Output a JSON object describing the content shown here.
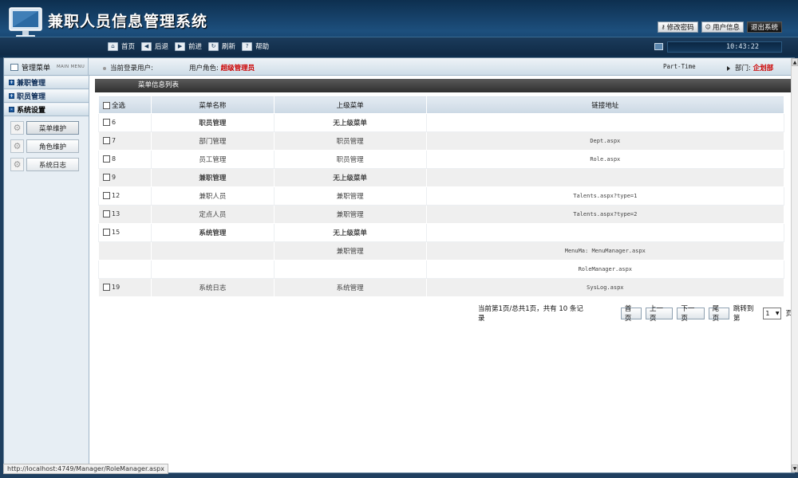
{
  "app": {
    "title": "兼职人员信息管理系统"
  },
  "header_buttons": [
    {
      "label": "修改密码",
      "icon": "key-icon"
    },
    {
      "label": "用户信息",
      "icon": "user-icon"
    },
    {
      "label": "退出系统",
      "icon": ""
    }
  ],
  "toolbar": {
    "items": [
      {
        "label": "首页",
        "icon": "home-icon",
        "glyph": "⌂"
      },
      {
        "label": "后退",
        "icon": "back-arrow-icon",
        "glyph": "◀"
      },
      {
        "label": "前进",
        "icon": "forward-arrow-icon",
        "glyph": "▶"
      },
      {
        "label": "刷新",
        "icon": "refresh-icon",
        "glyph": "↻"
      },
      {
        "label": "帮助",
        "icon": "help-icon",
        "glyph": "?"
      }
    ],
    "clock": "10:43:22"
  },
  "infobar": {
    "menu_title": "管理菜单",
    "menu_title_en": "MAIN MENU",
    "current_user_label": "当前登录用户:",
    "role_label": "用户角色:",
    "role_value": "超级管理员",
    "mode": "Part-Time",
    "dept_label": "部门:",
    "dept_value": "企划部"
  },
  "sidebar": {
    "groups": [
      {
        "label": "兼职管理",
        "open": false
      },
      {
        "label": "职员管理",
        "open": false
      },
      {
        "label": "系统设置",
        "open": true
      }
    ],
    "sub_items": [
      {
        "label": "菜单维护",
        "active": true
      },
      {
        "label": "角色维护",
        "active": false
      },
      {
        "label": "系统日志",
        "active": false
      }
    ]
  },
  "panel": {
    "title": "菜单信息列表",
    "columns": [
      "全选",
      "菜单名称",
      "上级菜单",
      "链接地址"
    ],
    "rows": [
      {
        "id": "6",
        "name": "职员管理",
        "parent": "无上级菜单",
        "url": "",
        "top": true
      },
      {
        "id": "7",
        "name": "部门管理",
        "parent": "职员管理",
        "url": "Dept.aspx",
        "top": false
      },
      {
        "id": "8",
        "name": "员工管理",
        "parent": "职员管理",
        "url": "Role.aspx",
        "top": false
      },
      {
        "id": "9",
        "name": "兼职管理",
        "parent": "无上级菜单",
        "url": "",
        "top": true
      },
      {
        "id": "12",
        "name": "兼职人员",
        "parent": "兼职管理",
        "url": "Talents.aspx?type=1",
        "top": false
      },
      {
        "id": "13",
        "name": "定点人员",
        "parent": "兼职管理",
        "url": "Talents.aspx?type=2",
        "top": false
      },
      {
        "id": "15",
        "name": "系统管理",
        "parent": "无上级菜单",
        "url": "",
        "top": true
      },
      {
        "id": "",
        "name": "",
        "parent": "兼职管理",
        "url": "MenuMa: MenuManager.aspx",
        "top": false,
        "nocheck": true
      },
      {
        "id": "",
        "name": "",
        "parent": "",
        "url": "RoleManager.aspx",
        "top": false,
        "nocheck": true
      },
      {
        "id": "19",
        "name": "系统日志",
        "parent": "系统管理",
        "url": "SysLog.aspx",
        "top": false
      }
    ]
  },
  "pager": {
    "info": "当前第1页/总共1页，共有 10 条记录",
    "first": "首页",
    "prev": "上一页",
    "next": "下一页",
    "last": "尾页",
    "jump_label": "跳转到第",
    "page_value": "1",
    "page_suffix": "页"
  },
  "statusbar": {
    "url": "http://localhost:4749/Manager/RoleManager.aspx"
  },
  "colors": {
    "header_bg": "#1d4f7d",
    "accent_red": "#cc0000",
    "menu_blue": "#0a1f80"
  }
}
